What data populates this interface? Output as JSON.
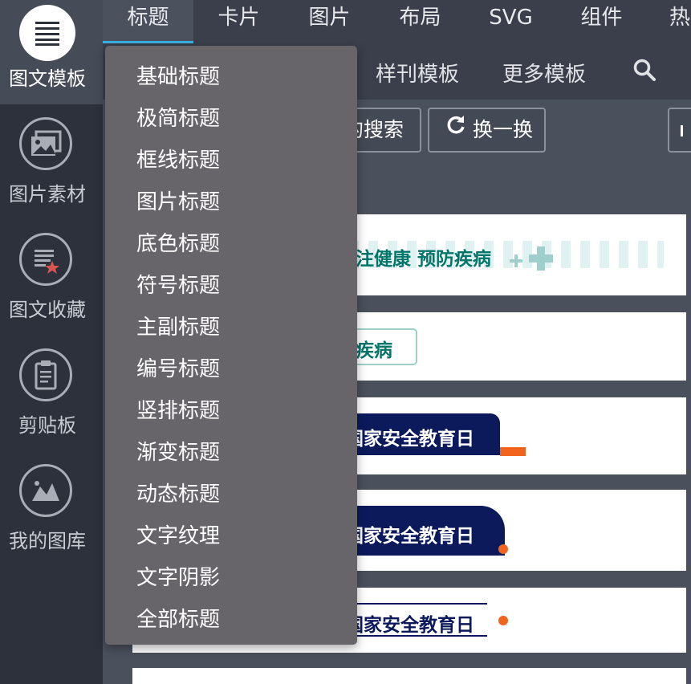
{
  "sidebar": {
    "items": [
      {
        "label": "图文模板",
        "icon": "list-icon",
        "active": true
      },
      {
        "label": "图片素材",
        "icon": "image-icon"
      },
      {
        "label": "图文收藏",
        "icon": "favorite-doc-icon"
      },
      {
        "label": "剪贴板",
        "icon": "clipboard-icon"
      },
      {
        "label": "我的图库",
        "icon": "gallery-icon"
      }
    ]
  },
  "tabs": [
    {
      "label": "标题",
      "active": true
    },
    {
      "label": "卡片"
    },
    {
      "label": "图片"
    },
    {
      "label": "布局"
    },
    {
      "label": "SVG"
    },
    {
      "label": "组件"
    },
    {
      "label": "热"
    }
  ],
  "subnav": {
    "links": [
      "样刊模板",
      "更多模板"
    ],
    "search_icon": "search-icon"
  },
  "buttons": {
    "search_label": "的搜索",
    "refresh_label": "换一换",
    "refresh_icon": "refresh-icon"
  },
  "templates": [
    {
      "text": "注健康 预防疾病",
      "color": "#00756a"
    },
    {
      "text": "疾病",
      "color": "#00756a"
    },
    {
      "text": "国家安全教育日",
      "color": "#ffffff"
    },
    {
      "text": "国家安全教育日",
      "color": "#ffffff"
    },
    {
      "text": "国家安全教育日",
      "color": "#0c1a5c"
    }
  ],
  "dropdown": {
    "items": [
      "基础标题",
      "极简标题",
      "框线标题",
      "图片标题",
      "底色标题",
      "符号标题",
      "主副标题",
      "编号标题",
      "竖排标题",
      "渐变标题",
      "动态标题",
      "文字纹理",
      "文字阴影",
      "全部标题"
    ]
  },
  "colors": {
    "accent": "#3ab0e2",
    "navy": "#0c1a5c",
    "orange": "#f0641e",
    "teal": "#00756a"
  }
}
